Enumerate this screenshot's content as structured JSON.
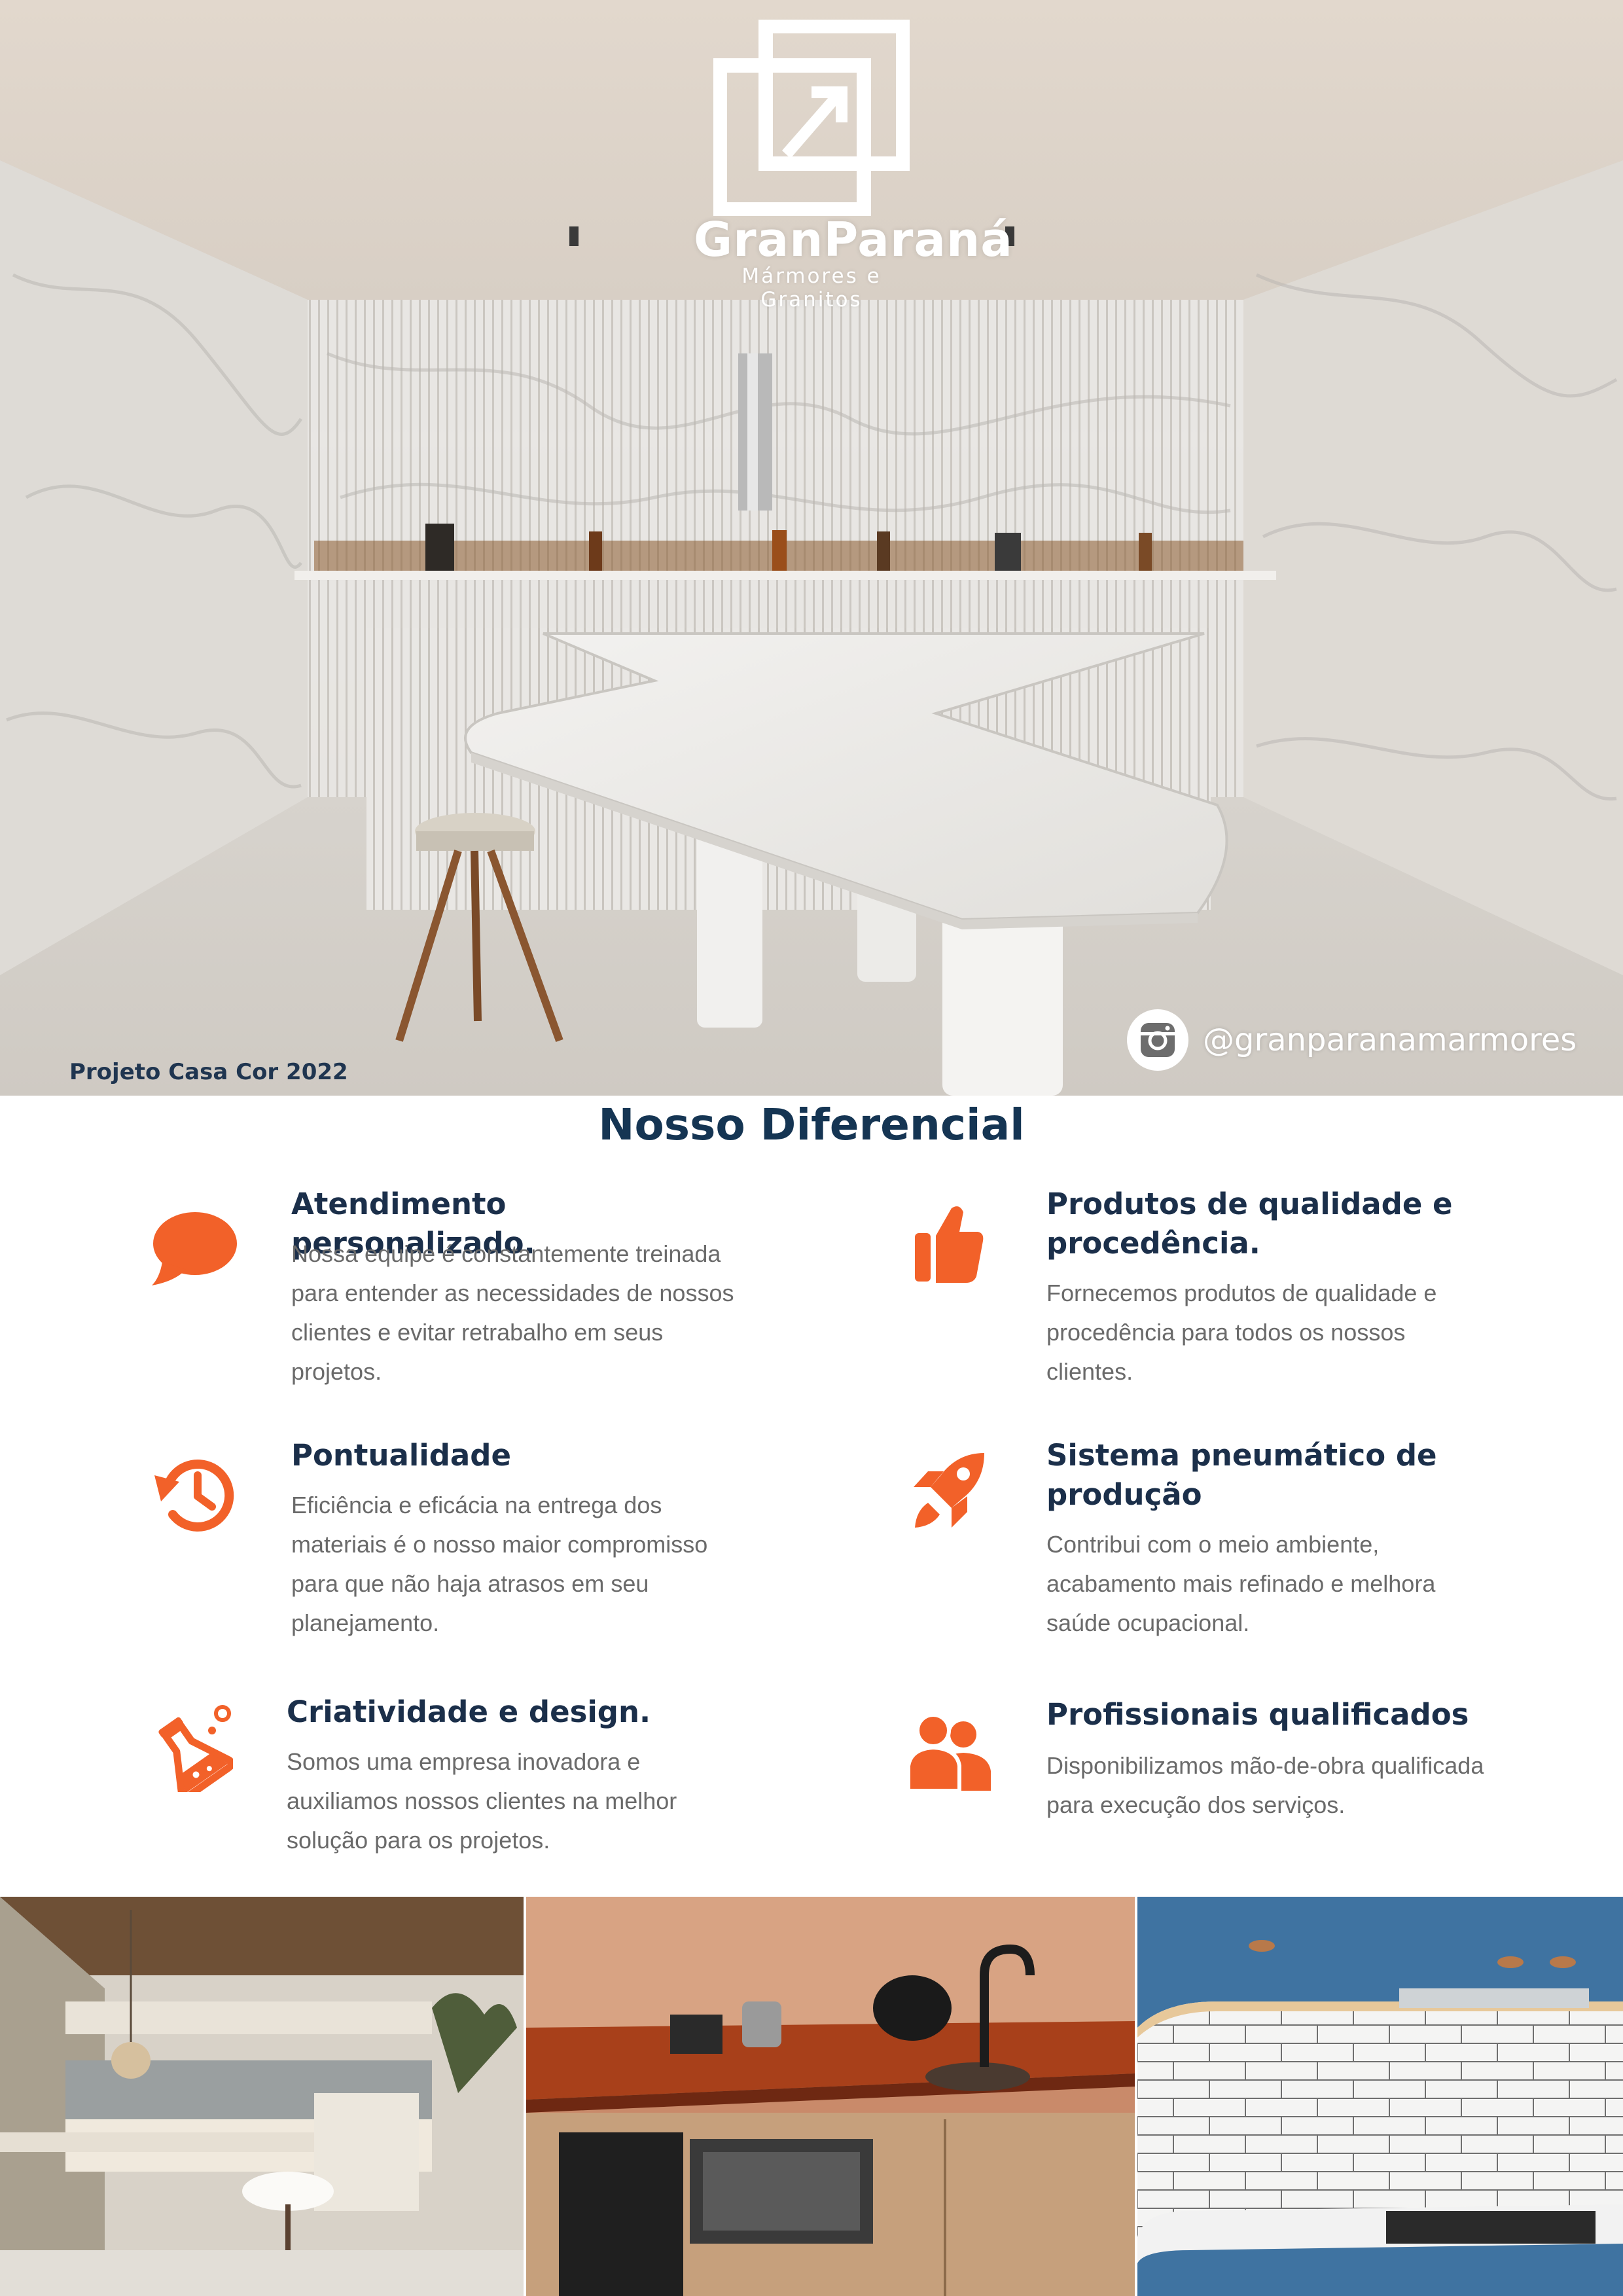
{
  "brand": {
    "name": "GranParaná",
    "tagline": "Mármores e Granitos"
  },
  "hero": {
    "caption": "Projeto Casa Cor 2022",
    "instagram_handle": "@granparanamarmores"
  },
  "section": {
    "title": "Nosso Diferencial"
  },
  "features": [
    {
      "icon": "chat-bubble-icon",
      "title": "Atendimento personalizado.",
      "text_lines": [
        "Nossa equipe é constantemente treinada",
        "para entender as necessidades de nossos",
        "clientes e evitar retrabalho em seus",
        "projetos."
      ]
    },
    {
      "icon": "thumbs-up-icon",
      "title_lines": [
        "Produtos de qualidade e",
        "procedência."
      ],
      "text_lines": [
        "Fornecemos produtos de qualidade e",
        "procedência para todos os nossos",
        "clientes."
      ]
    },
    {
      "icon": "history-clock-icon",
      "title": "Pontualidade",
      "text_lines": [
        "Eficiência e eficácia na entrega dos",
        "materiais é o nosso maior compromisso",
        "para que não haja atrasos em seu",
        "planejamento."
      ]
    },
    {
      "icon": "rocket-icon",
      "title_lines": [
        "Sistema pneumático de",
        "produção"
      ],
      "text_lines": [
        "Contribui com o meio ambiente,",
        "acabamento mais refinado e melhora",
        "saúde ocupacional."
      ]
    },
    {
      "icon": "flask-icon",
      "title": "Criatividade e design.",
      "text_lines": [
        "Somos uma empresa inovadora e",
        "auxiliamos nossos clientes na melhor",
        "solução para os projetos."
      ]
    },
    {
      "icon": "users-icon",
      "title": "Profissionais qualificados",
      "text_lines": [
        "Disponibilizamos mão-de-obra qualificada",
        "para execução dos serviços."
      ]
    }
  ],
  "colors": {
    "accent": "#f26129",
    "heading": "#153553",
    "body_text": "#6a6a6a"
  }
}
